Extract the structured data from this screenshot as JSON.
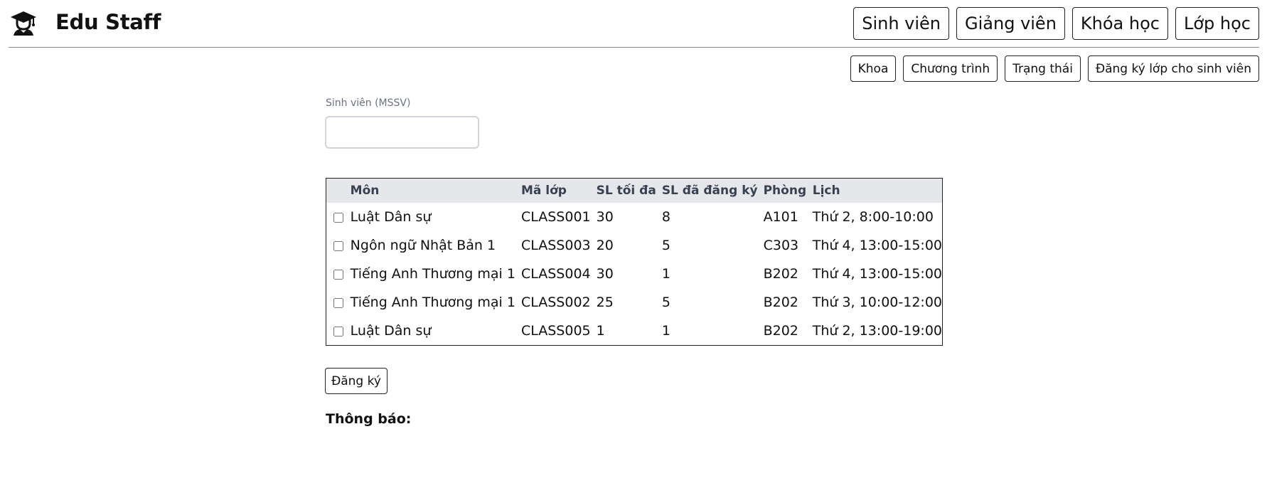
{
  "brand": {
    "name": "Edu Staff",
    "icon": "graduation-cap-icon"
  },
  "nav_main": [
    "Sinh viên",
    "Giảng viên",
    "Khóa học",
    "Lớp học"
  ],
  "nav_sub": [
    "Khoa",
    "Chương trình",
    "Trạng thái",
    "Đăng ký lớp cho sinh viên"
  ],
  "student_field": {
    "label": "Sinh viên (MSSV)",
    "value": "",
    "placeholder": ""
  },
  "table": {
    "columns": [
      "",
      "Môn",
      "Mã lớp",
      "SL tối đa",
      "SL đã đăng ký",
      "Phòng",
      "Lịch"
    ],
    "rows": [
      {
        "checked": false,
        "cells": [
          "Luật Dân sự",
          "CLASS001",
          "30",
          "8",
          "A101",
          "Thứ 2, 8:00-10:00"
        ]
      },
      {
        "checked": false,
        "cells": [
          "Ngôn ngữ Nhật Bản 1",
          "CLASS003",
          "20",
          "5",
          "C303",
          "Thứ 4, 13:00-15:00"
        ]
      },
      {
        "checked": false,
        "cells": [
          "Tiếng Anh Thương mại 1",
          "CLASS004",
          "30",
          "1",
          "B202",
          "Thứ 4, 13:00-15:00"
        ]
      },
      {
        "checked": false,
        "cells": [
          "Tiếng Anh Thương mại 1",
          "CLASS002",
          "25",
          "5",
          "B202",
          "Thứ 3, 10:00-12:00"
        ]
      },
      {
        "checked": false,
        "cells": [
          "Luật Dân sự",
          "CLASS005",
          "1",
          "1",
          "B202",
          "Thứ 2, 13:00-19:00"
        ]
      }
    ]
  },
  "register_button": "Đăng ký",
  "notice_label": "Thông báo:",
  "colors": {
    "table_header_bg": "#e5e7eb",
    "label_gray": "#6b7280",
    "border": "#222222"
  }
}
